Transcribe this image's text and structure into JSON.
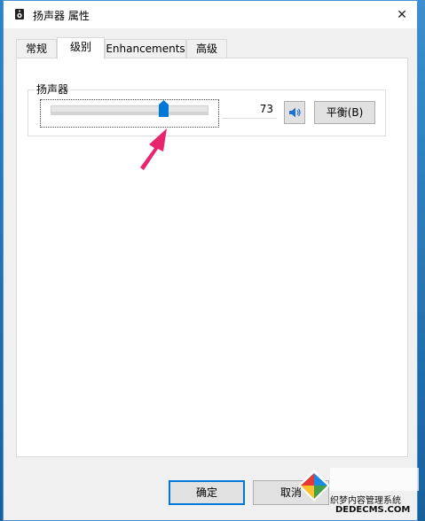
{
  "window": {
    "title": "扬声器 属性",
    "close_glyph": "✕"
  },
  "tabs": [
    {
      "label": "常规",
      "active": false
    },
    {
      "label": "级别",
      "active": true
    },
    {
      "label": "Enhancements",
      "active": false
    },
    {
      "label": "高级",
      "active": false
    }
  ],
  "levels": {
    "group_label": "扬声器",
    "volume_value": "73",
    "volume_level": 0.73,
    "mute_icon": "speaker-icon",
    "balance_label": "平衡(B)"
  },
  "buttons": {
    "ok_label": "确定",
    "cancel_label": "取消"
  },
  "watermark": {
    "line1": "织梦内容管理系统",
    "line2": "DEDECMS.COM"
  },
  "colors": {
    "accent": "#0078d7",
    "arrow": "#e8246e"
  }
}
